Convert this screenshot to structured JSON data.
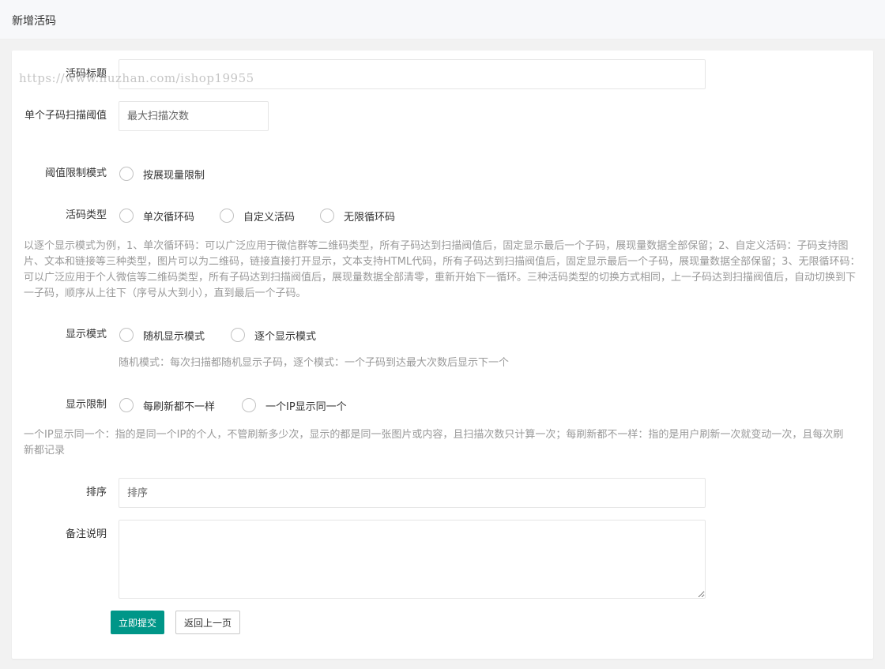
{
  "header": {
    "title": "新增活码"
  },
  "watermark": "https://www.huzhan.com/ishop19955",
  "form": {
    "title_label": "活码标题",
    "threshold_label": "单个子码扫描阈值",
    "threshold_placeholder": "最大扫描次数",
    "threshold_mode_label": "阈值限制模式",
    "threshold_mode_options": [
      "按展现量限制"
    ],
    "type_label": "活码类型",
    "type_options": [
      "单次循环码",
      "自定义活码",
      "无限循环码"
    ],
    "type_note": "以逐个显示模式为例，1、单次循环码：可以广泛应用于微信群等二维码类型，所有子码达到扫描阀值后，固定显示最后一个子码，展现量数据全部保留；2、自定义活码：子码支持图片、文本和链接等三种类型，图片可以为二维码，链接直接打开显示，文本支持HTML代码，所有子码达到扫描阀值后，固定显示最后一个子码，展现量数据全部保留；3、无限循环码：可以广泛应用于个人微信等二维码类型，所有子码达到扫描阀值后，展现量数据全部清零，重新开始下一循环。三种活码类型的切换方式相同，上一子码达到扫描阀值后，自动切换到下一子码，顺序从上往下（序号从大到小），直到最后一个子码。",
    "display_mode_label": "显示模式",
    "display_mode_options": [
      "随机显示模式",
      "逐个显示模式"
    ],
    "display_mode_note": "随机模式：每次扫描都随机显示子码，逐个模式：一个子码到达最大次数后显示下一个",
    "display_limit_label": "显示限制",
    "display_limit_options": [
      "每刷新都不一样",
      "一个IP显示同一个"
    ],
    "display_limit_note": "一个IP显示同一个：指的是同一个IP的个人，不管刷新多少次，显示的都是同一张图片或内容，且扫描次数只计算一次；每刷新都不一样：指的是用户刷新一次就变动一次，且每次刷新都记录",
    "sort_label": "排序",
    "sort_placeholder": "排序",
    "remark_label": "备注说明",
    "submit_label": "立即提交",
    "back_label": "返回上一页"
  },
  "colors": {
    "primary": "#009688",
    "note": "#999999",
    "border": "#e6e6e6"
  }
}
